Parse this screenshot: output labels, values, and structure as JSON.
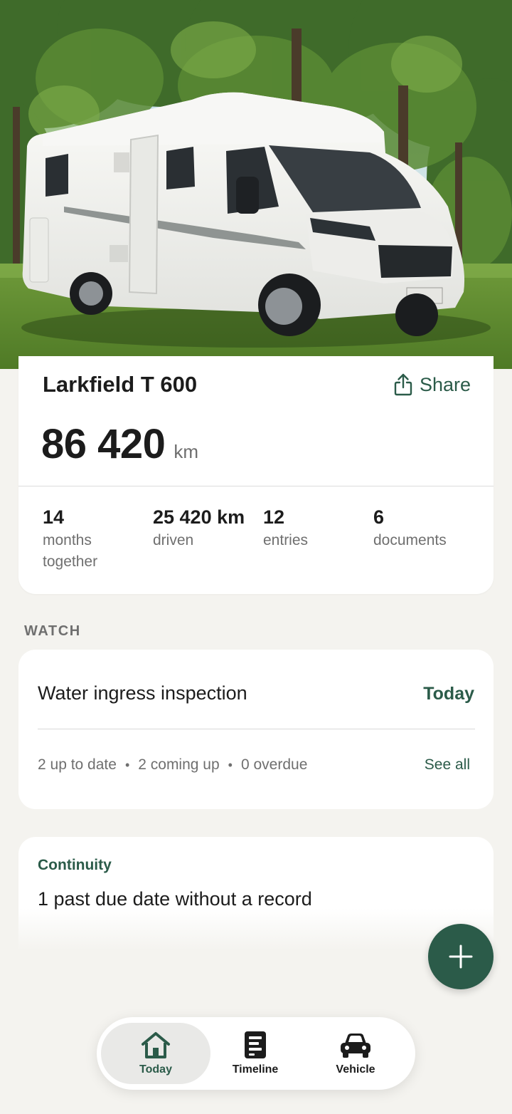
{
  "vehicle": {
    "name": "Larkfield T 600",
    "share_label": "Share",
    "odometer_value": "86420",
    "odometer_display": "86 420",
    "odometer_unit": "km",
    "stats": [
      {
        "value": "14",
        "label": "months together"
      },
      {
        "value": "25 420 km",
        "label": "driven"
      },
      {
        "value": "12",
        "label": "entries"
      },
      {
        "value": "6",
        "label": "documents"
      }
    ]
  },
  "watch": {
    "section_title": "WATCH",
    "title": "Water ingress inspection",
    "due": "Today",
    "summary": [
      "2 up to date",
      "2 coming up",
      "0 overdue"
    ],
    "see_all": "See all"
  },
  "continuity": {
    "label": "Continuity",
    "title": "1 past due date without a record"
  },
  "nav": {
    "items": [
      {
        "label": "Today",
        "icon": "home-icon",
        "active": true
      },
      {
        "label": "Timeline",
        "icon": "timeline-icon",
        "active": false
      },
      {
        "label": "Vehicle",
        "icon": "car-icon",
        "active": false
      }
    ]
  },
  "colors": {
    "accent": "#2b5b49",
    "background": "#f4f3ef",
    "card": "#ffffff",
    "muted_text": "#6f6f6f"
  }
}
